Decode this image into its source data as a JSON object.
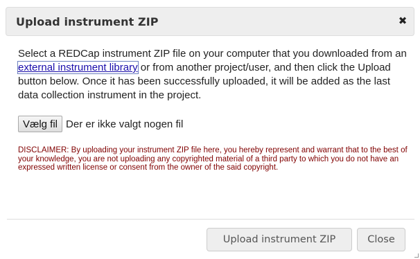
{
  "dialog": {
    "title": "Upload instrument ZIP",
    "close_icon": "close-icon",
    "close_glyph": "✖",
    "intro_before_link": "Select a REDCap instrument ZIP file on your computer that you downloaded from an ",
    "link_text": "external instrument library",
    "intro_after_link": " or from another project/user, and then click the Upload button below. Once it has been successfully uploaded, it will be added as the last data collection instrument in the project.",
    "file_button_label": "Vælg fil",
    "file_status": "Der er ikke valgt nogen fil",
    "disclaimer": "DISCLAIMER: By uploading your instrument ZIP file here, you hereby represent and warrant that to the best of your knowledge, you are not uploading any copyrighted material of a third party to which you do not have an expressed written license or consent from the owner of the said copyright.",
    "upload_button_label": "Upload instrument ZIP",
    "close_button_label": "Close"
  },
  "colors": {
    "disclaimer_text": "#800000",
    "link": "#1a0dab",
    "titlebar_bg": "#eeeeee"
  }
}
